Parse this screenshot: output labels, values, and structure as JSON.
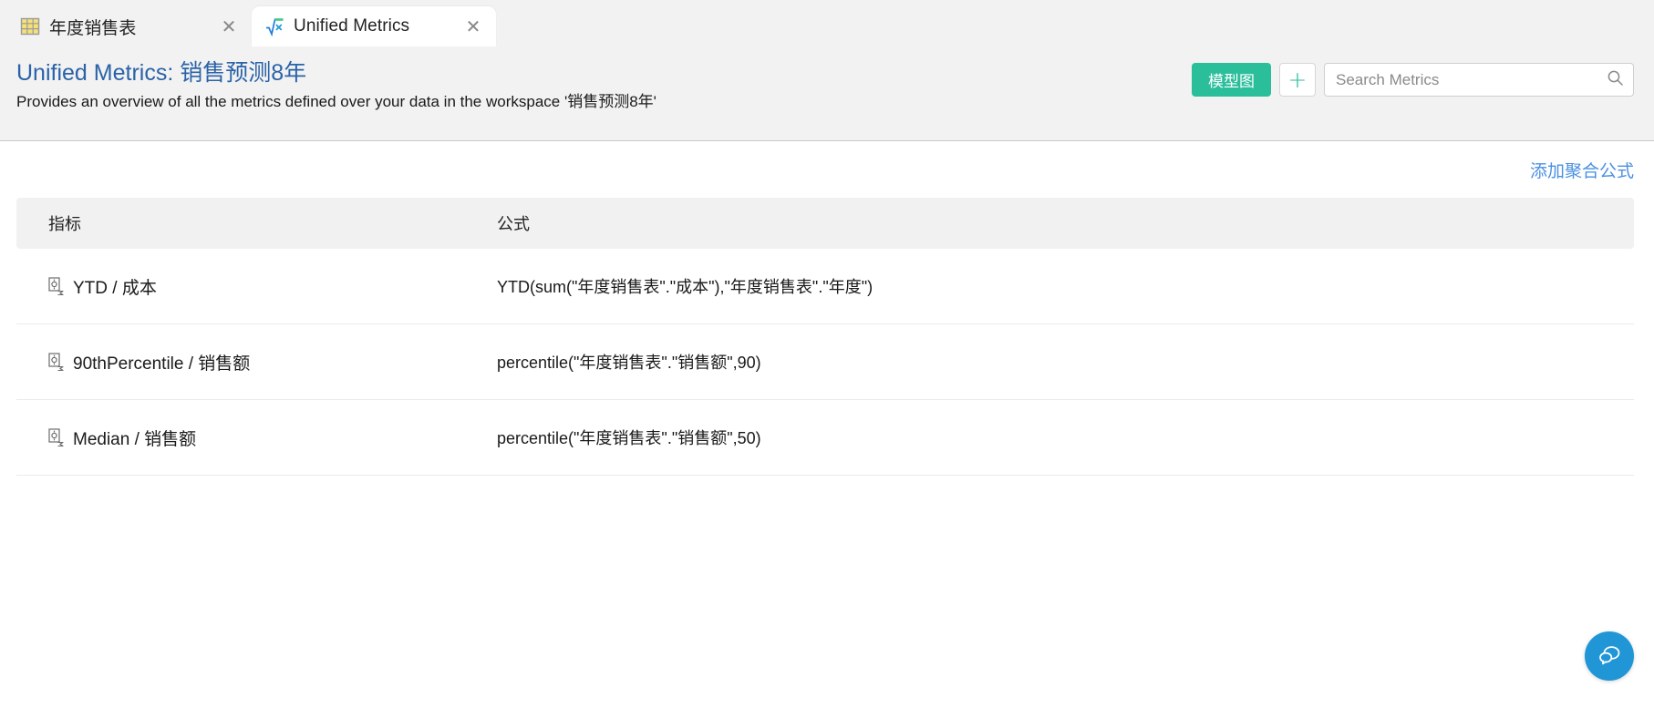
{
  "tabs": [
    {
      "label": "年度销售表",
      "icon": "table-grid-icon",
      "close": "✕",
      "active": false
    },
    {
      "label": "Unified Metrics",
      "icon": "sqrt-fx-icon",
      "close": "✕",
      "active": true
    }
  ],
  "header": {
    "title": "Unified Metrics: 销售预测8年",
    "subtitle": "Provides an overview of all the metrics defined over your data in the workspace '销售预测8年'",
    "model_button_label": "模型图",
    "add_button_label": "+",
    "search": {
      "placeholder": "Search Metrics",
      "value": "",
      "icon": "search-icon"
    }
  },
  "toolbar": {
    "add_aggregate_link": "添加聚合公式"
  },
  "table": {
    "columns": [
      "指标",
      "公式"
    ],
    "rows": [
      {
        "icon": "metric-measure-icon",
        "metric": "YTD / 成本",
        "formula": "YTD(sum(\"年度销售表\".\"成本\"),\"年度销售表\".\"年度\")"
      },
      {
        "icon": "metric-measure-icon",
        "metric": "90thPercentile / 销售额",
        "formula": "percentile(\"年度销售表\".\"销售额\",90)"
      },
      {
        "icon": "metric-measure-icon",
        "metric": "Median / 销售额",
        "formula": "percentile(\"年度销售表\".\"销售额\",50)"
      }
    ]
  },
  "fab": {
    "icon": "chat-bubbles-icon",
    "label": ""
  },
  "colors": {
    "title_blue": "#2a63a8",
    "accent_teal": "#2bbe9b",
    "link_blue": "#4a90e2",
    "fab_blue": "#2196d6",
    "header_bg": "#f2f2f2",
    "table_header_bg": "#f1f1f1"
  }
}
